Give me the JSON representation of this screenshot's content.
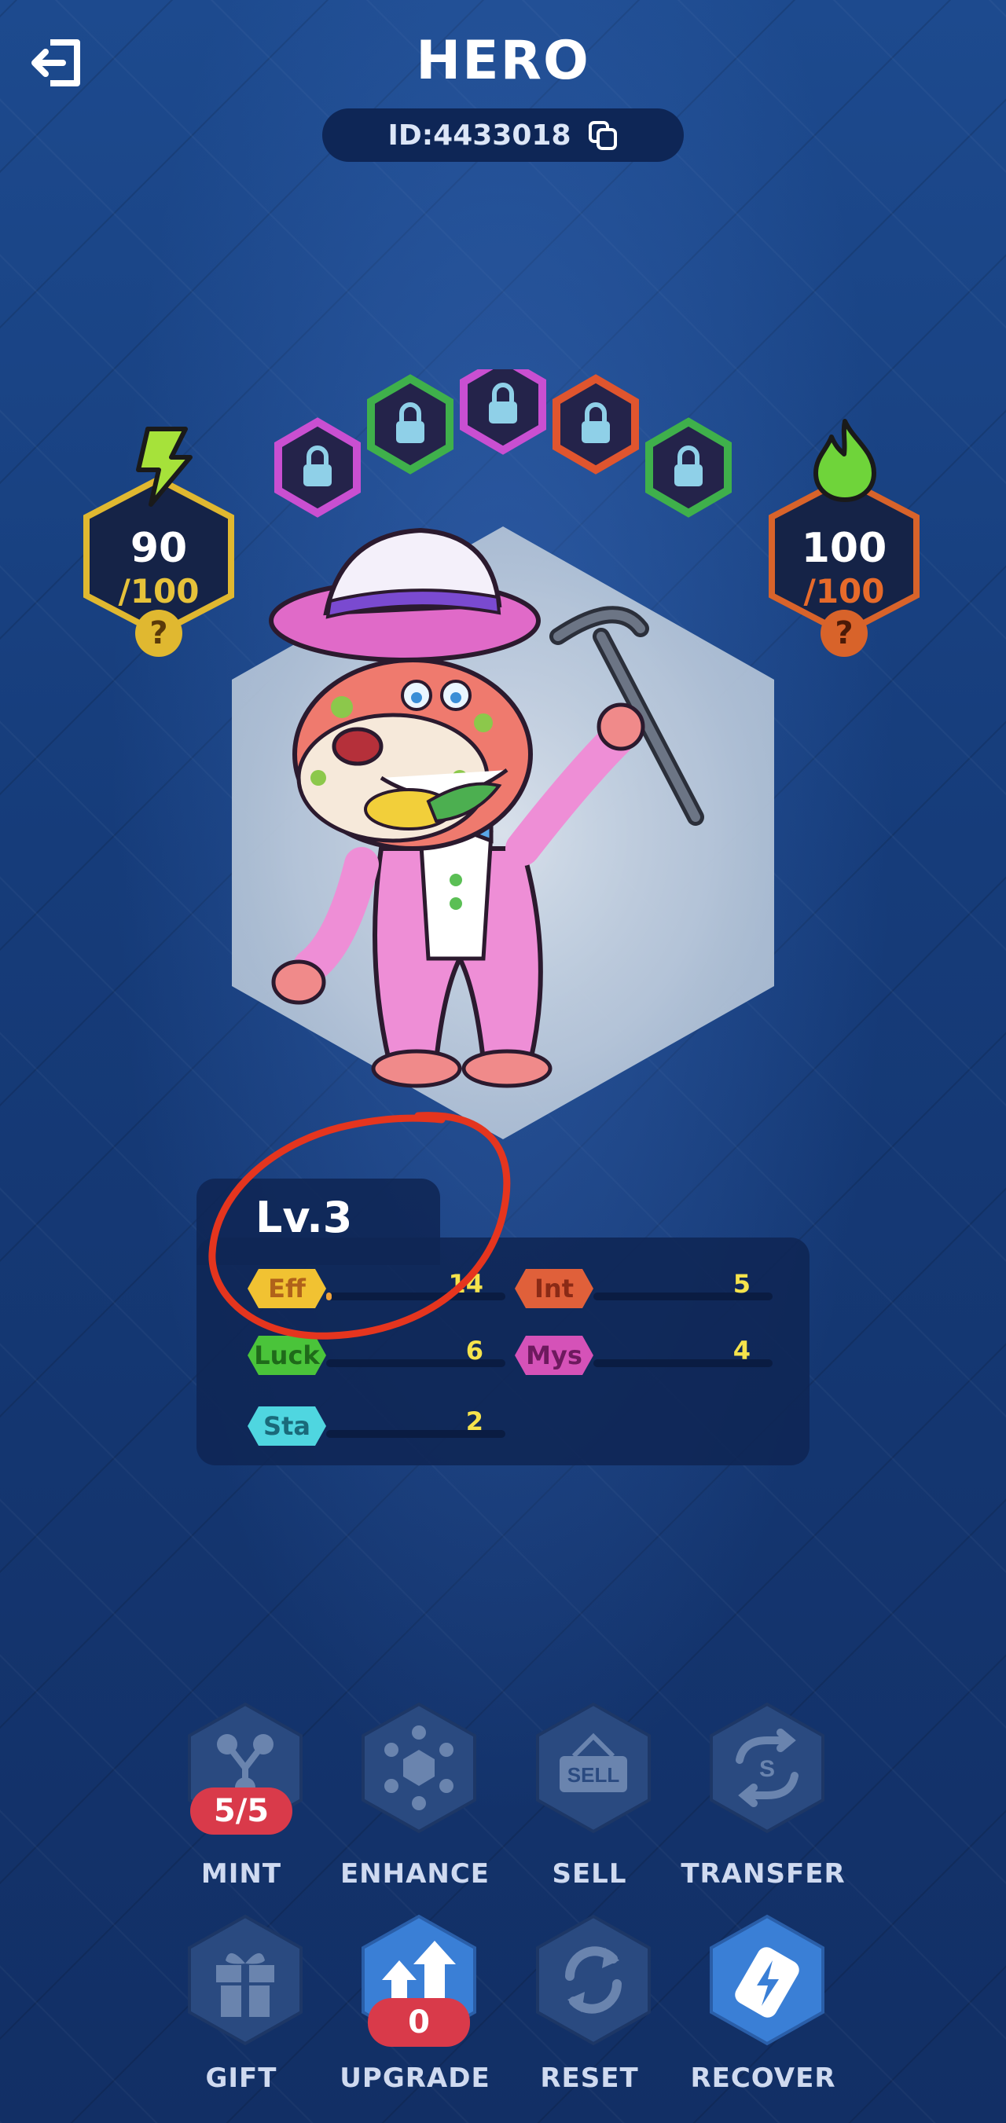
{
  "header": {
    "title": "HERO",
    "id_text": "ID:4433018"
  },
  "energy": {
    "current": "90",
    "max": "/100",
    "help": "?"
  },
  "fire": {
    "current": "100",
    "max": "/100",
    "help": "?"
  },
  "level": "Lv.3",
  "stats": [
    {
      "key": "eff",
      "label": "Eff",
      "value": "14",
      "fill": 0.03,
      "color": "#f1c232",
      "text_color": "#b0621a"
    },
    {
      "key": "int",
      "label": "Int",
      "value": "5",
      "fill": 0.0,
      "color": "#e0603a",
      "text_color": "#8a2a16"
    },
    {
      "key": "luck",
      "label": "Luck",
      "value": "6",
      "fill": 0.0,
      "color": "#4ac43a",
      "text_color": "#1f6a1a"
    },
    {
      "key": "mys",
      "label": "Mys",
      "value": "4",
      "fill": 0.0,
      "color": "#d552b8",
      "text_color": "#6d1a5e"
    },
    {
      "key": "sta",
      "label": "Sta",
      "value": "2",
      "fill": 0.0,
      "color": "#4fd6e0",
      "text_color": "#1a6a7a"
    }
  ],
  "actions": [
    {
      "key": "mint",
      "label": "MINT",
      "badge": "5/5",
      "icon": "mint-icon"
    },
    {
      "key": "enhance",
      "label": "ENHANCE",
      "icon": "enhance-icon"
    },
    {
      "key": "sell",
      "label": "SELL",
      "sign": "SELL",
      "icon": "sell-sign-icon"
    },
    {
      "key": "transfer",
      "label": "TRANSFER",
      "icon": "transfer-icon"
    },
    {
      "key": "gift",
      "label": "GIFT",
      "icon": "gift-icon"
    },
    {
      "key": "upgrade",
      "label": "UPGRADE",
      "badge": "0",
      "icon": "upgrade-arrows-icon"
    },
    {
      "key": "reset",
      "label": "RESET",
      "icon": "reset-icon"
    },
    {
      "key": "recover",
      "label": "RECOVER",
      "icon": "battery-bolt-icon"
    }
  ],
  "gem_slots": [
    {
      "color": "#c94fd1",
      "icon": "lock-icon"
    },
    {
      "color": "#3fb04b",
      "icon": "lock-icon"
    },
    {
      "color": "#c94fd1",
      "icon": "lock-icon"
    },
    {
      "color": "#e0552e",
      "icon": "lock-icon"
    },
    {
      "color": "#3fb04b",
      "icon": "lock-icon"
    }
  ]
}
